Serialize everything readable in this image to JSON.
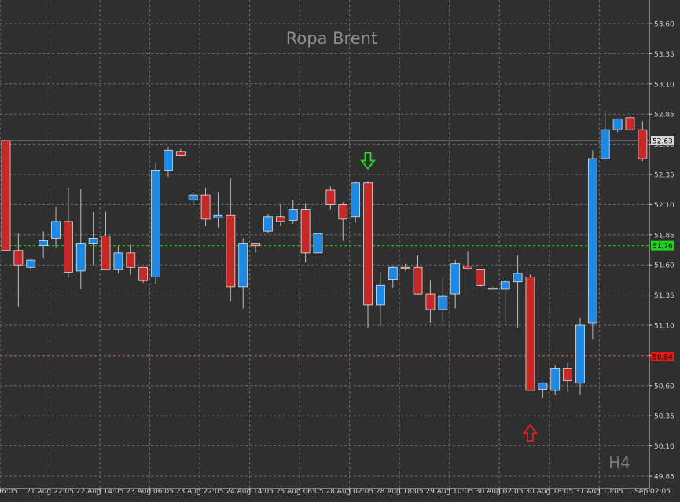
{
  "chart_data": {
    "type": "candlestick",
    "title": "Ropa Brent",
    "timeframe": "H4",
    "ylim": [
      49.85,
      53.6
    ],
    "y_ticks": [
      "53.60",
      "53.35",
      "53.10",
      "52.85",
      "52.60",
      "52.35",
      "52.10",
      "51.85",
      "51.60",
      "51.35",
      "51.10",
      "50.85",
      "50.60",
      "50.35",
      "50.10",
      "49.85"
    ],
    "x_ticks": [
      "06:05",
      "21 Aug 22:05",
      "22 Aug 14:05",
      "23 Aug 06:05",
      "23 Aug 22:05",
      "24 Aug 14:05",
      "25 Aug 06:05",
      "28 Aug 02:05",
      "28 Aug 18:05",
      "29 Aug 10:05",
      "30 Aug 02:05",
      "30 Aug 18:05",
      "31 Aug 10:05",
      "1 Sep 02:05"
    ],
    "x_tick_index": [
      0,
      4,
      8,
      12,
      16,
      20,
      24,
      28,
      32,
      36,
      40,
      44,
      48,
      52
    ],
    "levels": [
      {
        "label": "52.63",
        "value": 52.63,
        "color": "#8c8c8c",
        "style": "solid",
        "label_bg": "#d9d9d9",
        "label_fg": "#000000"
      },
      {
        "label": "51.76",
        "value": 51.76,
        "color": "#27c227",
        "style": "dashed",
        "label_bg": "#22d022",
        "label_fg": "#000000"
      },
      {
        "label": "50.84",
        "value": 50.84,
        "color": "#c22727",
        "style": "dashed",
        "label_bg": "#e01818",
        "label_fg": "#000000"
      }
    ],
    "arrows": [
      {
        "type": "down",
        "index": 29,
        "price": 52.45,
        "color": "#22e022"
      },
      {
        "type": "up",
        "index": 42,
        "price": 50.22,
        "color": "#e02222"
      }
    ],
    "colors": {
      "background": "#2f2f2f",
      "grid": "#6e6e6e",
      "bull": "#1e88e5",
      "bear": "#c62828",
      "wick": "#bdbdbd",
      "axis": "#cfcfcf",
      "title": "#8f8f8f"
    },
    "candles": [
      {
        "o": 52.63,
        "h": 52.72,
        "l": 51.5,
        "c": 51.72
      },
      {
        "o": 51.72,
        "h": 51.86,
        "l": 51.25,
        "c": 51.6
      },
      {
        "o": 51.58,
        "h": 51.66,
        "l": 51.55,
        "c": 51.64
      },
      {
        "o": 51.76,
        "h": 51.88,
        "l": 51.66,
        "c": 51.8
      },
      {
        "o": 51.82,
        "h": 52.08,
        "l": 51.74,
        "c": 51.96
      },
      {
        "o": 51.96,
        "h": 52.24,
        "l": 51.5,
        "c": 51.54
      },
      {
        "o": 51.55,
        "h": 52.23,
        "l": 51.4,
        "c": 51.78
      },
      {
        "o": 51.78,
        "h": 52.04,
        "l": 51.6,
        "c": 51.82
      },
      {
        "o": 51.84,
        "h": 52.04,
        "l": 51.56,
        "c": 51.56
      },
      {
        "o": 51.56,
        "h": 51.76,
        "l": 51.53,
        "c": 51.7
      },
      {
        "o": 51.7,
        "h": 51.77,
        "l": 51.52,
        "c": 51.58
      },
      {
        "o": 51.58,
        "h": 51.52,
        "l": 51.45,
        "c": 51.47
      },
      {
        "o": 51.5,
        "h": 52.45,
        "l": 51.44,
        "c": 52.38
      },
      {
        "o": 52.38,
        "h": 52.58,
        "l": 52.33,
        "c": 52.55
      },
      {
        "o": 52.54,
        "h": 52.56,
        "l": 52.5,
        "c": 52.51
      },
      {
        "o": 52.14,
        "h": 52.2,
        "l": 52.1,
        "c": 52.18
      },
      {
        "o": 52.18,
        "h": 52.24,
        "l": 51.92,
        "c": 51.98
      },
      {
        "o": 51.99,
        "h": 52.2,
        "l": 51.91,
        "c": 52.01
      },
      {
        "o": 52.01,
        "h": 52.32,
        "l": 51.3,
        "c": 51.42
      },
      {
        "o": 51.42,
        "h": 51.82,
        "l": 51.24,
        "c": 51.78
      },
      {
        "o": 51.78,
        "h": 51.78,
        "l": 51.7,
        "c": 51.76
      },
      {
        "o": 51.88,
        "h": 52.02,
        "l": 51.86,
        "c": 52.0
      },
      {
        "o": 52.0,
        "h": 52.1,
        "l": 51.92,
        "c": 51.96
      },
      {
        "o": 51.97,
        "h": 52.14,
        "l": 51.94,
        "c": 52.06
      },
      {
        "o": 52.06,
        "h": 52.11,
        "l": 51.62,
        "c": 51.7
      },
      {
        "o": 51.7,
        "h": 51.99,
        "l": 51.5,
        "c": 51.86
      },
      {
        "o": 52.22,
        "h": 52.25,
        "l": 52.06,
        "c": 52.1
      },
      {
        "o": 52.1,
        "h": 52.12,
        "l": 51.8,
        "c": 51.98
      },
      {
        "o": 52.0,
        "h": 52.29,
        "l": 51.95,
        "c": 52.28
      },
      {
        "o": 52.28,
        "h": 52.29,
        "l": 51.08,
        "c": 51.27
      },
      {
        "o": 51.27,
        "h": 51.54,
        "l": 51.09,
        "c": 51.43
      },
      {
        "o": 51.48,
        "h": 51.59,
        "l": 51.41,
        "c": 51.58
      },
      {
        "o": 51.58,
        "h": 51.61,
        "l": 51.55,
        "c": 51.57
      },
      {
        "o": 51.58,
        "h": 51.68,
        "l": 51.35,
        "c": 51.36
      },
      {
        "o": 51.36,
        "h": 51.47,
        "l": 51.12,
        "c": 51.23
      },
      {
        "o": 51.23,
        "h": 51.5,
        "l": 51.1,
        "c": 51.34
      },
      {
        "o": 51.36,
        "h": 51.64,
        "l": 51.24,
        "c": 51.61
      },
      {
        "o": 51.59,
        "h": 51.71,
        "l": 51.56,
        "c": 51.57
      },
      {
        "o": 51.56,
        "h": 51.56,
        "l": 51.42,
        "c": 51.43
      },
      {
        "o": 51.41,
        "h": 51.42,
        "l": 51.4,
        "c": 51.41
      },
      {
        "o": 51.4,
        "h": 51.48,
        "l": 51.1,
        "c": 51.46
      },
      {
        "o": 51.46,
        "h": 51.68,
        "l": 51.08,
        "c": 51.53
      },
      {
        "o": 51.5,
        "h": 51.52,
        "l": 50.56,
        "c": 50.56
      },
      {
        "o": 50.57,
        "h": 50.63,
        "l": 50.5,
        "c": 50.62
      },
      {
        "o": 50.56,
        "h": 50.77,
        "l": 50.52,
        "c": 50.74
      },
      {
        "o": 50.74,
        "h": 50.79,
        "l": 50.55,
        "c": 50.64
      },
      {
        "o": 50.62,
        "h": 51.16,
        "l": 50.52,
        "c": 51.1
      },
      {
        "o": 51.12,
        "h": 52.55,
        "l": 50.98,
        "c": 52.48
      },
      {
        "o": 52.48,
        "h": 52.88,
        "l": 52.46,
        "c": 52.72
      },
      {
        "o": 52.72,
        "h": 52.81,
        "l": 52.7,
        "c": 52.81
      },
      {
        "o": 52.82,
        "h": 52.87,
        "l": 52.66,
        "c": 52.72
      },
      {
        "o": 52.72,
        "h": 52.79,
        "l": 52.46,
        "c": 52.48
      }
    ]
  }
}
